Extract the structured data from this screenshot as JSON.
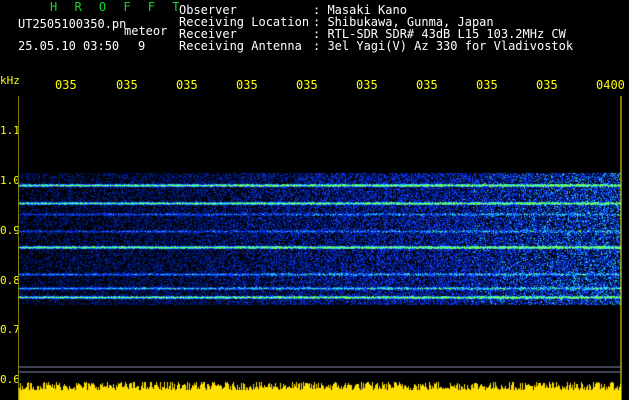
{
  "header": {
    "title": "H R O F F T",
    "filename": "UT2505100350.pn",
    "meteor_label": "meteor",
    "datetime": "25.05.10 03:50",
    "count": "9",
    "fields": [
      {
        "label": "Observer",
        "value": ": Masaki Kano"
      },
      {
        "label": "Receiving Location",
        "value": ": Shibukawa, Gunma, Japan"
      },
      {
        "label": "Receiver",
        "value": ": RTL-SDR SDR# 43dB L15 103.2MHz CW"
      },
      {
        "label": "Receiving Antenna",
        "value": ": 3el Yagi(V) Az 330 for Vladivostok"
      }
    ]
  },
  "time_axis": {
    "ticks": [
      "035",
      "035",
      "035",
      "035",
      "035",
      "035",
      "035",
      "035",
      "035",
      "0400"
    ]
  },
  "freq_axis": {
    "unit": "kHz",
    "ticks": [
      "1.1",
      "1.0",
      "0.9",
      "0.8",
      "0.7",
      "0.6"
    ]
  },
  "colors": {
    "header_green": "#10d830",
    "axis_yellow": "#ffff00",
    "signal_blue": "#1a3cff",
    "signal_cyan": "#22e0ff",
    "signal_green": "#60ff40",
    "noise_yellow": "#ffe000"
  }
}
